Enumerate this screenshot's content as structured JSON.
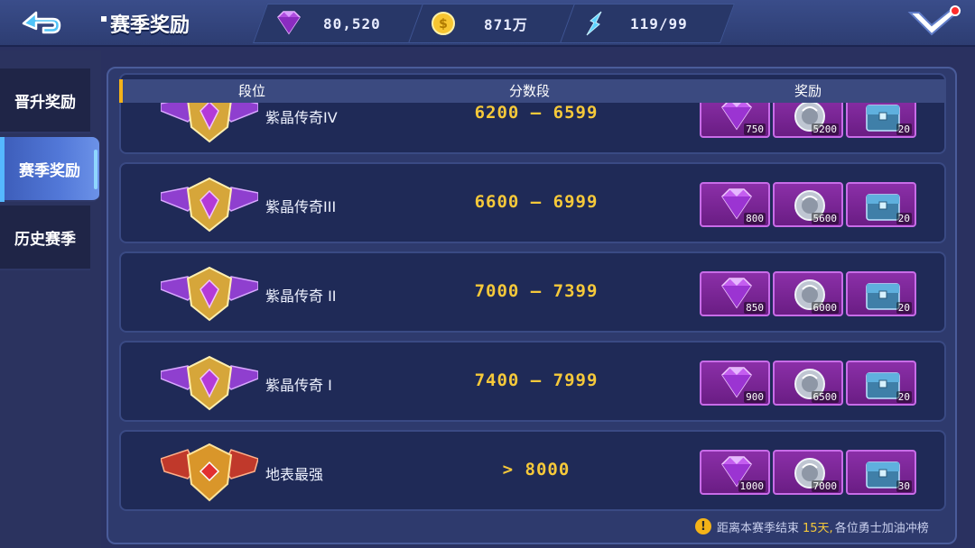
{
  "header": {
    "title": "赛季奖励",
    "resources": [
      {
        "icon": "purple-gem-icon",
        "value": "80,520"
      },
      {
        "icon": "gold-coin-icon",
        "value": "871万"
      },
      {
        "icon": "energy-feather-icon",
        "value": "119/99"
      }
    ]
  },
  "sidebar": {
    "tabs": [
      {
        "label": "晋升奖励",
        "active": false
      },
      {
        "label": "赛季奖励",
        "active": true
      },
      {
        "label": "历史赛季",
        "active": false
      }
    ]
  },
  "table": {
    "columns": [
      "段位",
      "分数段",
      "奖励"
    ],
    "rows": [
      {
        "rank": "紫晶传奇IV",
        "score": "6200 – 6599",
        "rewards": [
          "750",
          "5200",
          "20"
        ],
        "badge": "purple"
      },
      {
        "rank": "紫晶传奇III",
        "score": "6600 – 6999",
        "rewards": [
          "800",
          "5600",
          "20"
        ],
        "badge": "purple"
      },
      {
        "rank": "紫晶传奇 II",
        "score": "7000 – 7399",
        "rewards": [
          "850",
          "6000",
          "20"
        ],
        "badge": "purple"
      },
      {
        "rank": "紫晶传奇 I",
        "score": "7400 – 7999",
        "rewards": [
          "900",
          "6500",
          "20"
        ],
        "badge": "purple"
      },
      {
        "rank": "地表最强",
        "score": "> 8000",
        "rewards": [
          "1000",
          "7000",
          "30"
        ],
        "badge": "red"
      }
    ]
  },
  "footer": {
    "prefix": "距离本赛季结束",
    "days": "15天,",
    "suffix": "各位勇士加油冲榜"
  },
  "colors": {
    "accent_gold": "#f6c93a",
    "reward_purple": "#8b2fa8",
    "active_tab_blue": "#5278d8"
  }
}
